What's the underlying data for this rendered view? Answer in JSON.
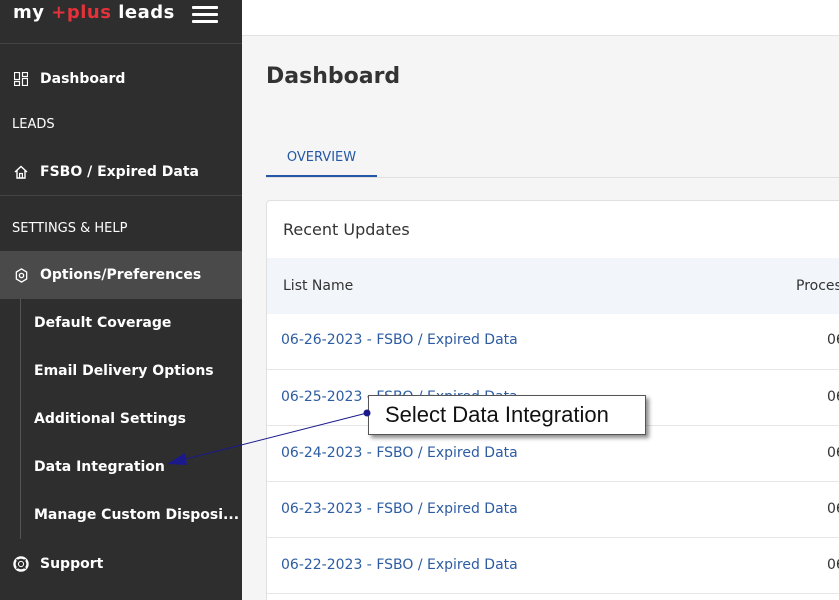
{
  "brand": {
    "part1": "my ",
    "part2": "+plus",
    "part3": " leads"
  },
  "sidebar": {
    "dashboard": "Dashboard",
    "leads_section": "LEADS",
    "fsbo": "FSBO / Expired Data",
    "settings_section": "SETTINGS & HELP",
    "options": "Options/Preferences",
    "sub_items": [
      "Default Coverage",
      "Email Delivery Options",
      "Additional Settings",
      "Data Integration",
      "Manage Custom Disposi..."
    ],
    "support": "Support"
  },
  "main": {
    "title": "Dashboard",
    "tab": "OVERVIEW",
    "card_title": "Recent Updates",
    "columns": [
      "List Name",
      "Proces"
    ],
    "rows": [
      {
        "name": "06-26-2023 - FSBO / Expired Data",
        "right": "06"
      },
      {
        "name": "06-25-2023 - FSBO / Expired Data",
        "right": "06"
      },
      {
        "name": "06-24-2023 - FSBO / Expired Data",
        "right": "06"
      },
      {
        "name": "06-23-2023 - FSBO / Expired Data",
        "right": "06"
      },
      {
        "name": "06-22-2023 - FSBO / Expired Data",
        "right": "06"
      }
    ]
  },
  "callout": {
    "text": "Select Data Integration"
  },
  "colors": {
    "sidebar": "#2e2e2e",
    "brand_accent": "#e4313a",
    "link": "#2d5ca3",
    "active": "#4a4a4a"
  },
  "icons": {
    "dashboard": "grid-icon",
    "fsbo": "home-icon",
    "options": "gear-icon",
    "support": "lifebuoy-icon",
    "menu": "hamburger-icon"
  }
}
